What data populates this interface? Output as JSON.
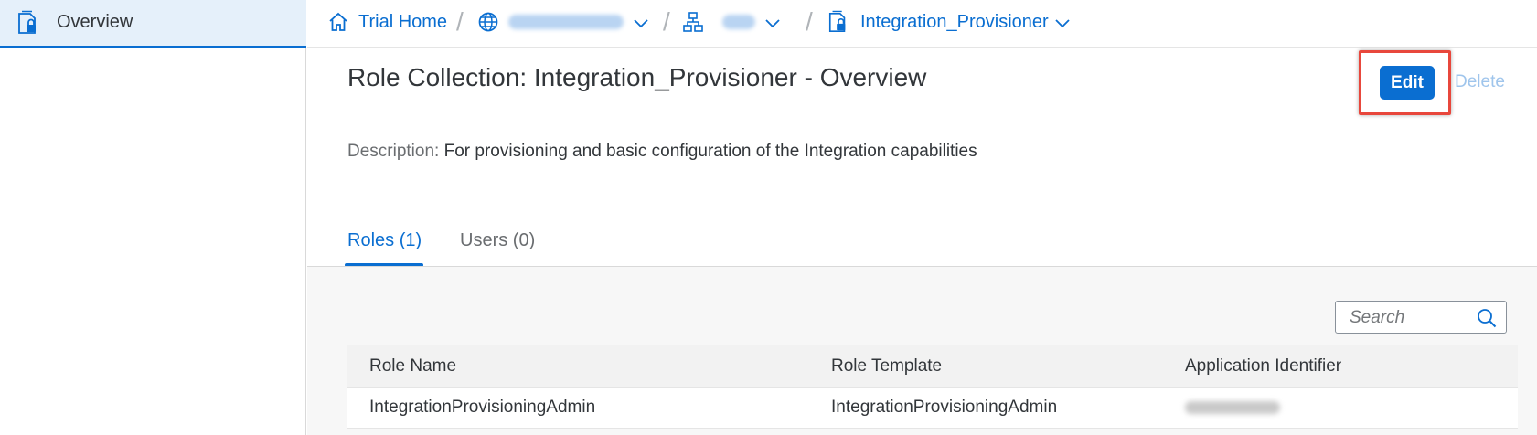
{
  "sidebar": {
    "items": [
      {
        "label": "Overview",
        "icon": "role-collection-lock-icon"
      }
    ]
  },
  "breadcrumb": {
    "home": {
      "label": "Trial Home",
      "icon": "home-icon"
    },
    "global_account": {
      "icon": "globe-icon",
      "label_redacted": true
    },
    "subaccount": {
      "icon": "hierarchy-icon",
      "label_redacted": true
    },
    "current": {
      "label": "Integration_Provisioner",
      "icon": "role-collection-lock-icon"
    }
  },
  "header": {
    "title": "Role Collection: Integration_Provisioner - Overview",
    "edit_label": "Edit",
    "delete_label": "Delete",
    "description_label": "Description:",
    "description_value": "For provisioning and basic configuration of the Integration capabilities"
  },
  "tabs": [
    {
      "label": "Roles (1)",
      "selected": true
    },
    {
      "label": "Users (0)",
      "selected": false
    }
  ],
  "search": {
    "placeholder": "Search",
    "icon": "search-icon"
  },
  "table": {
    "columns": [
      "Role Name",
      "Role Template",
      "Application Identifier"
    ],
    "rows": [
      {
        "role_name": "IntegrationProvisioningAdmin",
        "role_template": "IntegrationProvisioningAdmin",
        "application_identifier_redacted": true
      }
    ]
  },
  "colors": {
    "accent": "#0a6ed1",
    "highlight_border": "#e8473c",
    "content_background": "#f7f7f7",
    "sidebar_selected": "#e5f0fa"
  }
}
